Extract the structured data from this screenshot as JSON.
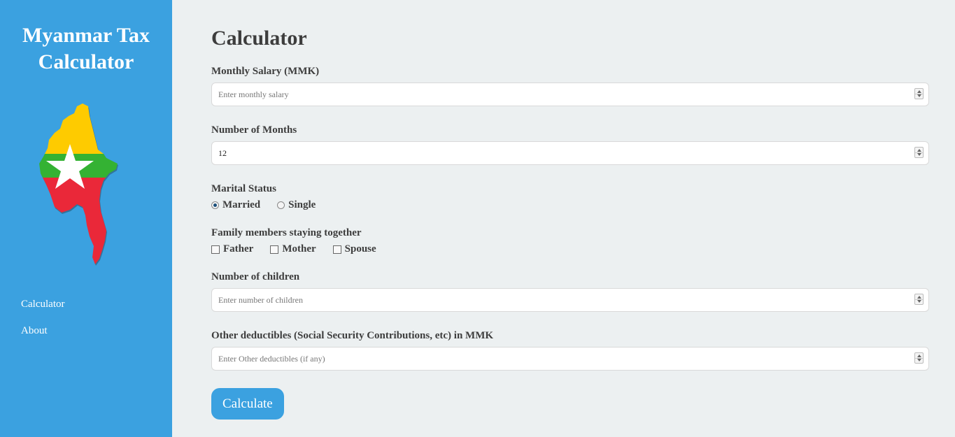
{
  "app": {
    "title": "Myanmar Tax Calculator"
  },
  "brand": {
    "sidebar_color": "#3ba1e0",
    "flag_yellow": "#fecb00",
    "flag_green": "#34b233",
    "flag_red": "#ea2839"
  },
  "sidebar": {
    "nav": [
      {
        "label": "Calculator",
        "icon": ""
      },
      {
        "label": "About",
        "icon": ""
      }
    ]
  },
  "page": {
    "title": "Calculator"
  },
  "form": {
    "monthly_salary": {
      "label": "Monthly Salary (MMK)",
      "placeholder": "Enter monthly salary",
      "value": ""
    },
    "months": {
      "label": "Number of Months",
      "value": "12"
    },
    "marital": {
      "label": "Marital Status",
      "options": [
        {
          "label": "Married",
          "checked": true
        },
        {
          "label": "Single",
          "checked": false
        }
      ]
    },
    "family": {
      "label": "Family members staying together",
      "options": [
        {
          "label": "Father",
          "checked": false
        },
        {
          "label": "Mother",
          "checked": false
        },
        {
          "label": "Spouse",
          "checked": false
        }
      ]
    },
    "children": {
      "label": "Number of children",
      "placeholder": "Enter number of children",
      "value": ""
    },
    "deductibles": {
      "label": "Other deductibles (Social Security Contributions, etc) in MMK",
      "placeholder": "Enter Other deductibles (if any)",
      "value": ""
    },
    "submit_label": "Calculate"
  }
}
